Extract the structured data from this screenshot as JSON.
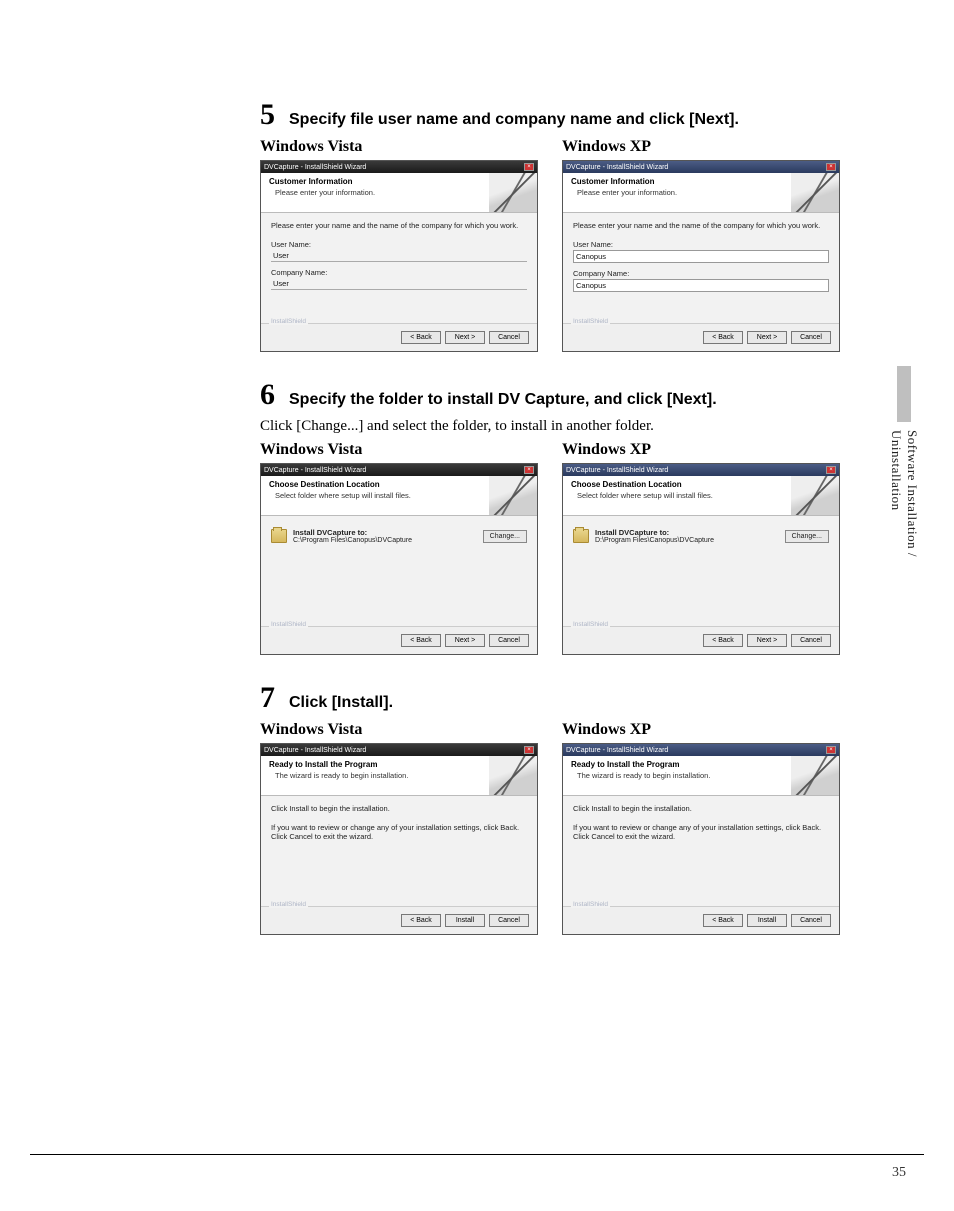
{
  "sideTab": "Software Installation / Uninstallation",
  "pageNumber": "35",
  "steps": [
    {
      "num": "5",
      "title": "Specify file user name and company name and click [Next].",
      "desc": "",
      "vistaLabel": "Windows Vista",
      "xpLabel": "Windows XP",
      "wizard": {
        "windowTitle": "DVCapture - InstallShield Wizard",
        "headerTitle": "Customer Information",
        "headerSub": "Please enter your information.",
        "prompt": "Please enter your name and the name of the company for which you work.",
        "userLabel": "User Name:",
        "companyLabel": "Company Name:",
        "vistaUser": "User",
        "vistaCompany": "User",
        "xpUser": "Canopus",
        "xpCompany": "Canopus",
        "brand": "InstallShield",
        "back": "< Back",
        "next": "Next >",
        "cancel": "Cancel"
      }
    },
    {
      "num": "6",
      "title": "Specify the folder to install DV Capture, and click [Next].",
      "desc": "Click [Change...] and select the folder, to install in another folder.",
      "vistaLabel": "Windows Vista",
      "xpLabel": "Windows XP",
      "wizard": {
        "windowTitle": "DVCapture - InstallShield Wizard",
        "headerTitle": "Choose Destination Location",
        "headerSub": "Select folder where setup will install files.",
        "destLabel": "Install DVCapture to:",
        "vistaPath": "C:\\Program Files\\Canopus\\DVCapture",
        "xpPath": "D:\\Program Files\\Canopus\\DVCapture",
        "change": "Change...",
        "brand": "InstallShield",
        "back": "< Back",
        "next": "Next >",
        "cancel": "Cancel"
      }
    },
    {
      "num": "7",
      "title": "Click [Install].",
      "desc": "",
      "vistaLabel": "Windows Vista",
      "xpLabel": "Windows XP",
      "wizard": {
        "windowTitle": "DVCapture - InstallShield Wizard",
        "headerTitle": "Ready to Install the Program",
        "headerSub": "The wizard is ready to begin installation.",
        "line1": "Click Install to begin the installation.",
        "line2": "If you want to review or change any of your installation settings, click Back. Click Cancel to exit the wizard.",
        "brand": "InstallShield",
        "back": "< Back",
        "install": "Install",
        "cancel": "Cancel"
      }
    }
  ]
}
